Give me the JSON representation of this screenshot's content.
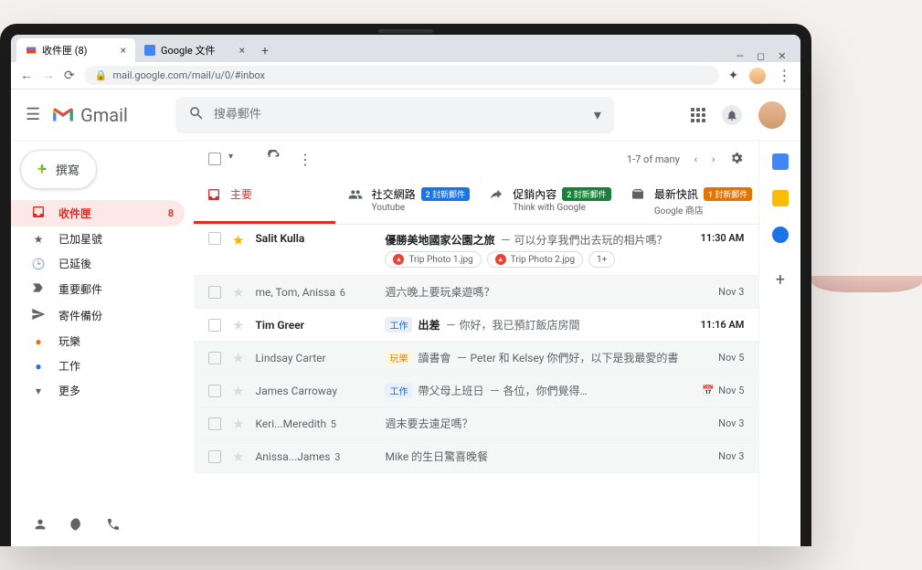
{
  "browser": {
    "tabs": [
      {
        "title": "收件匣 (8)",
        "icon": "gmail"
      },
      {
        "title": "Google 文件",
        "icon": "docs"
      }
    ],
    "url": "mail.google.com/mail/u/0/#inbox"
  },
  "header": {
    "brand": "Gmail",
    "search_placeholder": "搜尋郵件"
  },
  "compose_label": "撰寫",
  "sidebar": {
    "items": [
      {
        "icon": "inbox",
        "label": "收件匣",
        "count": "8",
        "active": true
      },
      {
        "icon": "star",
        "label": "已加星號"
      },
      {
        "icon": "clock",
        "label": "已延後"
      },
      {
        "icon": "important",
        "label": "重要郵件"
      },
      {
        "icon": "sent",
        "label": "寄件備份"
      },
      {
        "icon": "tag-play",
        "label": "玩樂"
      },
      {
        "icon": "tag-work",
        "label": "工作"
      },
      {
        "icon": "more",
        "label": "更多"
      }
    ]
  },
  "toolbar": {
    "range": "1-7 of many"
  },
  "category_tabs": [
    {
      "label": "主要",
      "active": true
    },
    {
      "label": "社交網路",
      "badge": "2 封新郵件",
      "badge_color": "blue",
      "sub": "Youtube"
    },
    {
      "label": "促銷內容",
      "badge": "2 封新郵件",
      "badge_color": "green",
      "sub": "Think with Google"
    },
    {
      "label": "最新快訊",
      "badge": "1 封新郵件",
      "badge_color": "orange",
      "sub": "Google 商店"
    }
  ],
  "emails": [
    {
      "starred": true,
      "unread": true,
      "sender": "Salit Kulla",
      "subject": "優勝美地國家公園之旅",
      "snippet": "－ 可以分享我們出去玩的相片嗎？",
      "attachments": [
        "Trip Photo 1.jpg",
        "Trip Photo 2.jpg"
      ],
      "attach_more": "1+",
      "date": "11:30 AM"
    },
    {
      "starred": false,
      "unread": false,
      "sender": "me, Tom, Anissa",
      "thread": "6",
      "subject": "週六晚上要玩桌遊嗎？",
      "snippet": "",
      "date": "Nov 3"
    },
    {
      "starred": false,
      "unread": true,
      "sender": "Tim Greer",
      "tag": "工作",
      "tag_type": "work",
      "subject": "出差",
      "snippet": "－ 你好，我已預訂飯店房間",
      "date": "11:16 AM"
    },
    {
      "starred": false,
      "unread": false,
      "sender": "Lindsay Carter",
      "tag": "玩樂",
      "tag_type": "play",
      "subject": "讀書會",
      "snippet": "－ Peter 和 Kelsey 你們好，以下是我最愛的書",
      "date": "Nov 5"
    },
    {
      "starred": false,
      "unread": false,
      "sender": "James Carroway",
      "tag": "工作",
      "tag_type": "work",
      "subject": "帶父母上班日",
      "snippet": "－ 各位，你們覺得…",
      "date": "Nov 5",
      "has_event": true
    },
    {
      "starred": false,
      "unread": false,
      "sender": "Keri...Meredith",
      "thread": "5",
      "subject": "週末要去遠足嗎？",
      "snippet": "",
      "date": "Nov 3"
    },
    {
      "starred": false,
      "unread": false,
      "sender": "Anissa...James",
      "thread": "3",
      "subject": "Mike 的生日驚喜晚餐",
      "snippet": "",
      "date": "Nov 3"
    }
  ]
}
